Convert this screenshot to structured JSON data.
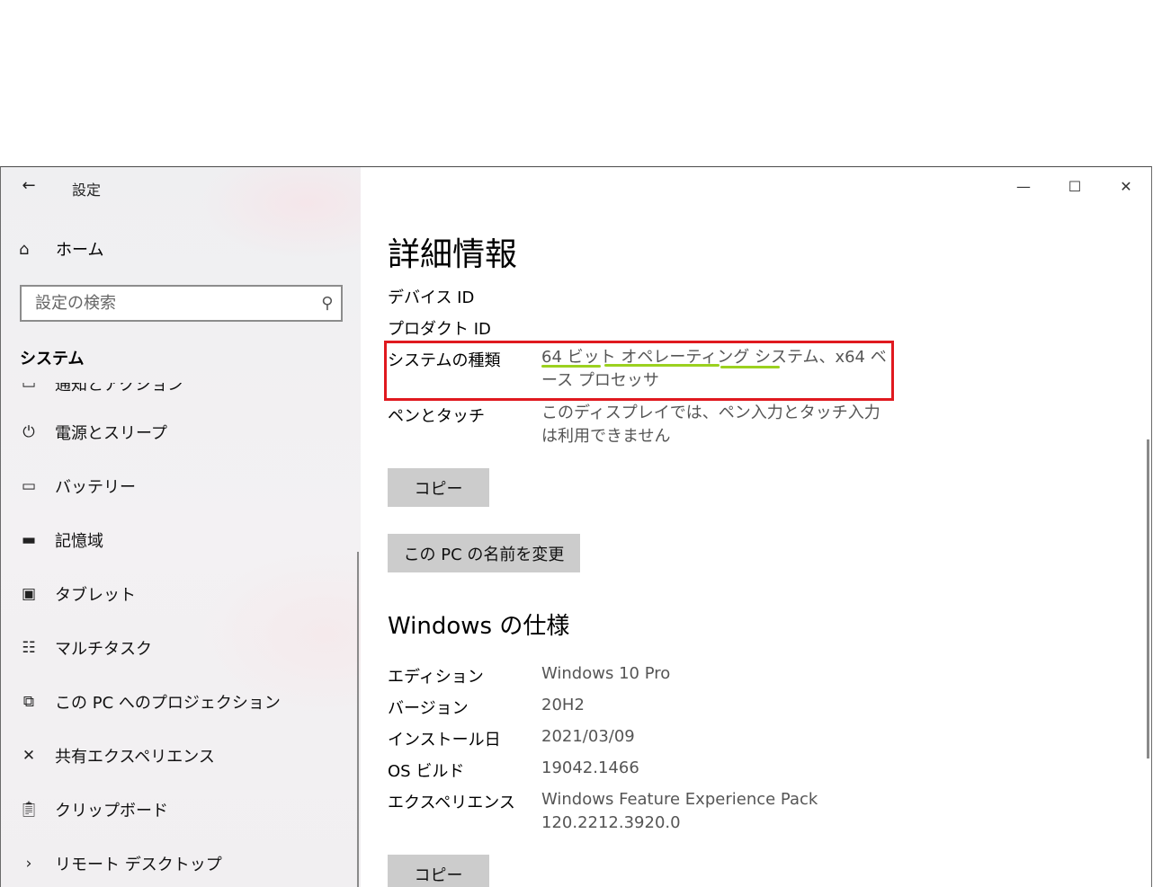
{
  "window": {
    "back_icon": "back-arrow-icon",
    "title": "設定",
    "controls": {
      "minimize": "—",
      "maximize": "☐",
      "close": "✕"
    }
  },
  "sidebar": {
    "home_label": "ホーム",
    "search_placeholder": "設定の検索",
    "section": "システム",
    "partial_item": "通知とアクション",
    "items": [
      {
        "label": "電源とスリープ",
        "icon": "power-icon"
      },
      {
        "label": "バッテリー",
        "icon": "battery-icon"
      },
      {
        "label": "記憶域",
        "icon": "storage-icon"
      },
      {
        "label": "タブレット",
        "icon": "tablet-icon"
      },
      {
        "label": "マルチタスク",
        "icon": "multitask-icon"
      },
      {
        "label": "この PC へのプロジェクション",
        "icon": "projection-icon"
      },
      {
        "label": "共有エクスペリエンス",
        "icon": "shared-experience-icon"
      },
      {
        "label": "クリップボード",
        "icon": "clipboard-icon"
      },
      {
        "label": "リモート デスクトップ",
        "icon": "remote-desktop-icon"
      }
    ]
  },
  "main": {
    "title": "詳細情報",
    "device_rows": [
      {
        "key": "デバイス ID",
        "value": ""
      },
      {
        "key": "プロダクト ID",
        "value": ""
      },
      {
        "key": "システムの種類",
        "value": "64 ビット オペレーティング システム、x64 ベース プロセッサ"
      },
      {
        "key": "ペンとタッチ",
        "value": "このディスプレイでは、ペン入力とタッチ入力は利用できません"
      }
    ],
    "copy_label": "コピー",
    "rename_label": "この PC の名前を変更",
    "windows_spec_title": "Windows の仕様",
    "spec_rows": [
      {
        "key": "エディション",
        "value": "Windows 10 Pro"
      },
      {
        "key": "バージョン",
        "value": "20H2"
      },
      {
        "key": "インストール日",
        "value": "2021/03/09"
      },
      {
        "key": "OS ビルド",
        "value": "19042.1466"
      },
      {
        "key": "エクスペリエンス",
        "value": "Windows Feature Experience Pack 120.2212.3920.0"
      }
    ],
    "copy2_label": "コピー"
  },
  "colors": {
    "highlight_box": "#e0191f",
    "underline": "#9bd11f"
  }
}
